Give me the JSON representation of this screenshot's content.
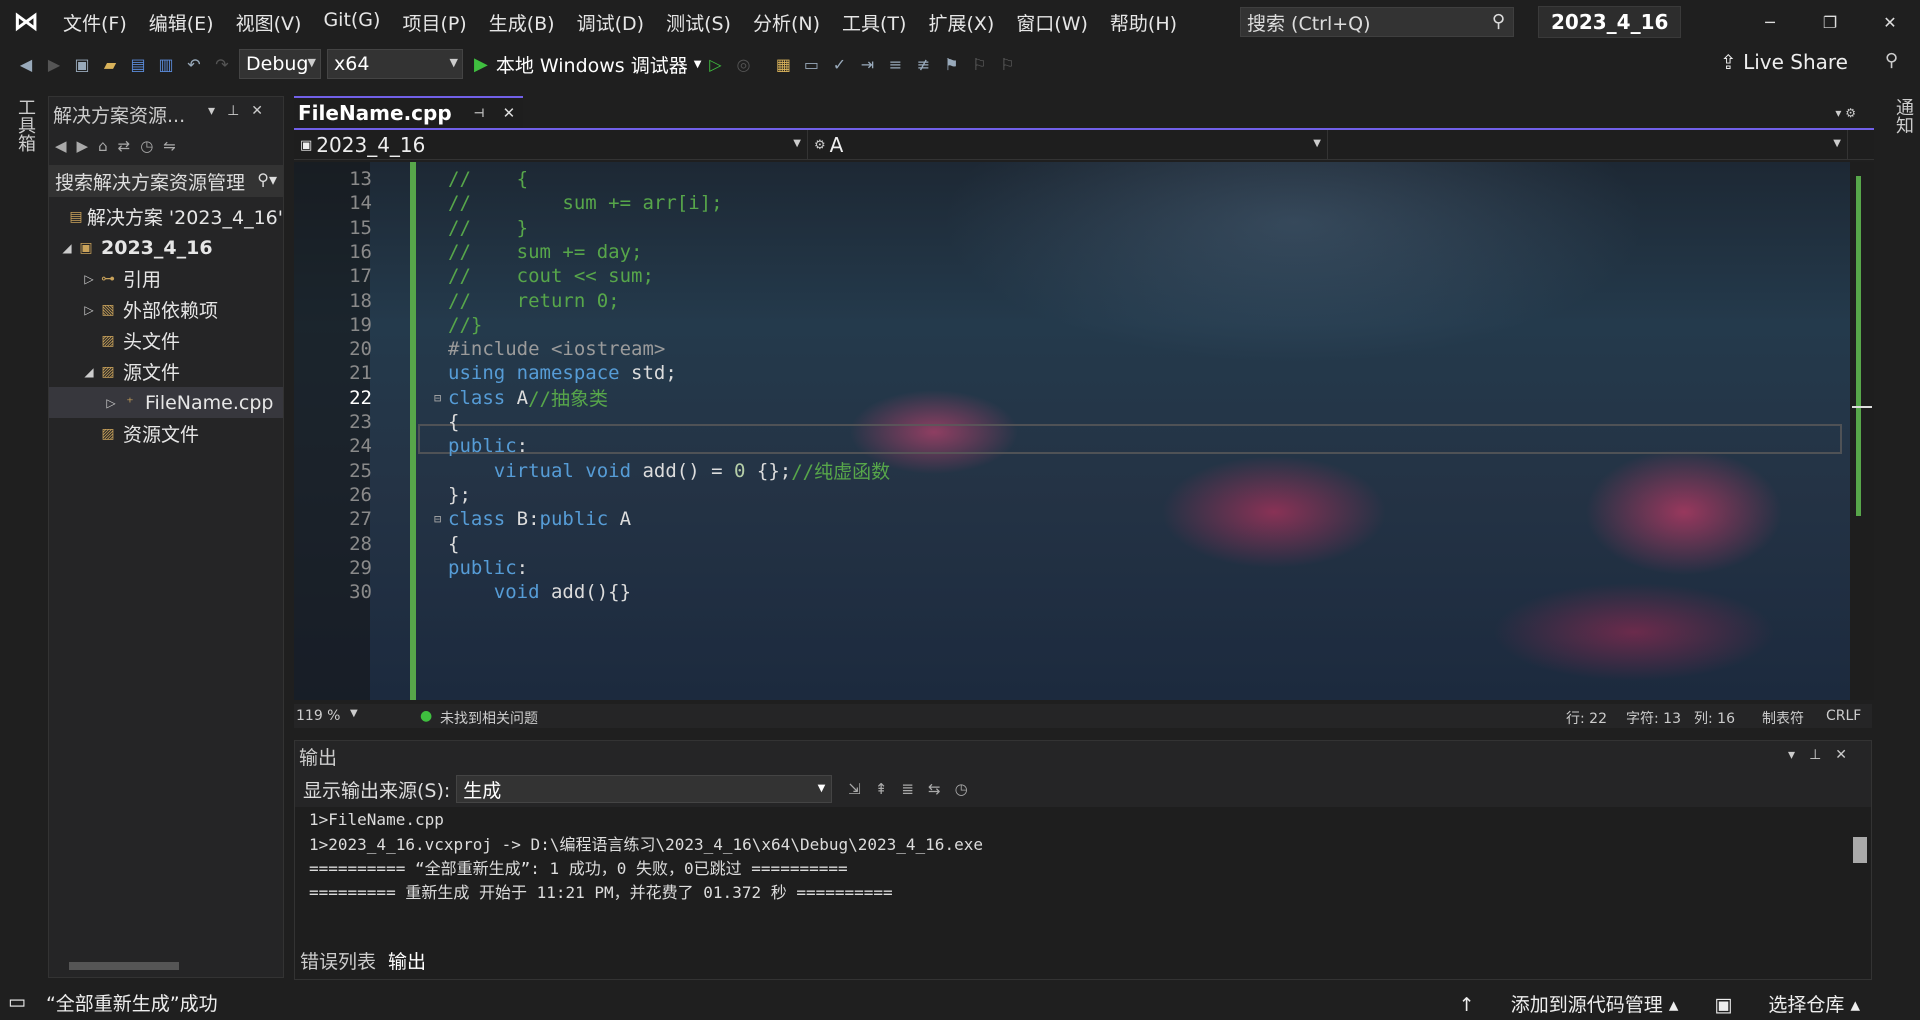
{
  "menubar": {
    "items": [
      "文件(F)",
      "编辑(E)",
      "视图(V)",
      "Git(G)",
      "项目(P)",
      "生成(B)",
      "调试(D)",
      "测试(S)",
      "分析(N)",
      "工具(T)",
      "扩展(X)",
      "窗口(W)",
      "帮助(H)"
    ],
    "search_placeholder": "搜索 (Ctrl+Q)",
    "project_title": "2023_4_16"
  },
  "toolbar": {
    "config": "Debug",
    "platform": "x64",
    "run_label": "本地 Windows 调试器",
    "live_share": "Live Share"
  },
  "side_strips": {
    "toolbox": "工具箱",
    "notifications": "通知"
  },
  "solution_explorer": {
    "title": "解决方案资源...",
    "search": "搜索解决方案资源管理",
    "tree": [
      {
        "label": "解决方案 '2023_4_16'",
        "indent": 0
      },
      {
        "label": "2023_4_16",
        "indent": 0
      },
      {
        "label": "引用",
        "indent": 1
      },
      {
        "label": "外部依赖项",
        "indent": 1
      },
      {
        "label": "头文件",
        "indent": 1
      },
      {
        "label": "源文件",
        "indent": 1
      },
      {
        "label": "FileName.cpp",
        "indent": 2
      },
      {
        "label": "资源文件",
        "indent": 1
      }
    ]
  },
  "editor": {
    "tab": "FileName.cpp",
    "nav_project": "2023_4_16",
    "nav_scope": "A",
    "current_line": 22,
    "lines": [
      {
        "n": 13,
        "tokens": [
          [
            "c-cm",
            "//    {"
          ]
        ]
      },
      {
        "n": 14,
        "tokens": [
          [
            "c-cm",
            "//        sum += arr[i];"
          ]
        ]
      },
      {
        "n": 15,
        "tokens": [
          [
            "c-cm",
            "//    }"
          ]
        ]
      },
      {
        "n": 16,
        "tokens": [
          [
            "c-cm",
            "//    sum += day;"
          ]
        ]
      },
      {
        "n": 17,
        "tokens": [
          [
            "c-cm",
            "//    cout << sum;"
          ]
        ]
      },
      {
        "n": 18,
        "tokens": [
          [
            "c-cm",
            "//    return 0;"
          ]
        ]
      },
      {
        "n": 19,
        "tokens": [
          [
            "c-cm",
            "//}"
          ]
        ]
      },
      {
        "n": 20,
        "tokens": [
          [
            "c-pp",
            "#include "
          ],
          [
            "c-pp",
            "<iostream>"
          ]
        ]
      },
      {
        "n": 21,
        "tokens": [
          [
            "c-kw",
            "using "
          ],
          [
            "c-kw",
            "namespace "
          ],
          [
            "c-id",
            "std;"
          ]
        ]
      },
      {
        "n": 22,
        "fold": true,
        "tokens": [
          [
            "c-kw",
            "class "
          ],
          [
            "c-id",
            "A"
          ],
          [
            "c-cm",
            "//抽象类"
          ]
        ]
      },
      {
        "n": 23,
        "tokens": [
          [
            "c-id",
            "{"
          ]
        ]
      },
      {
        "n": 24,
        "tokens": [
          [
            "c-kw",
            "public"
          ],
          [
            "c-id",
            ":"
          ]
        ]
      },
      {
        "n": 25,
        "tokens": [
          [
            "c-id",
            "    "
          ],
          [
            "c-kw",
            "virtual "
          ],
          [
            "c-kw",
            "void "
          ],
          [
            "c-id",
            "add() = "
          ],
          [
            "c-num",
            "0"
          ],
          [
            "c-id",
            " {};"
          ],
          [
            "c-cm",
            "//纯虚函数"
          ]
        ]
      },
      {
        "n": 26,
        "tokens": [
          [
            "c-id",
            "};"
          ]
        ]
      },
      {
        "n": 27,
        "fold": true,
        "tokens": [
          [
            "c-kw",
            "class "
          ],
          [
            "c-id",
            "B:"
          ],
          [
            "c-kw",
            "public "
          ],
          [
            "c-id",
            "A"
          ]
        ]
      },
      {
        "n": 28,
        "tokens": [
          [
            "c-id",
            "{"
          ]
        ]
      },
      {
        "n": 29,
        "tokens": [
          [
            "c-kw",
            "public"
          ],
          [
            "c-id",
            ":"
          ]
        ]
      },
      {
        "n": 30,
        "tokens": [
          [
            "c-id",
            "    "
          ],
          [
            "c-kw",
            "void "
          ],
          [
            "c-id",
            "add(){}"
          ]
        ]
      }
    ],
    "status": {
      "zoom": "119 %",
      "issues": "未找到相关问题",
      "row": "行: 22",
      "char": "字符: 13",
      "col": "列: 16",
      "tabs": "制表符",
      "eol": "CRLF"
    }
  },
  "output": {
    "title": "输出",
    "source_label": "显示输出来源(S):",
    "source_value": "生成",
    "lines": [
      "1>FileName.cpp",
      "1>2023_4_16.vcxproj -> D:\\编程语言练习\\2023_4_16\\x64\\Debug\\2023_4_16.exe",
      "========== “全部重新生成”: 1 成功，0 失败，0已跳过 ==========",
      "========= 重新生成 开始于 11:21 PM，并花费了 01.372 秒 =========="
    ]
  },
  "bottom_tabs": [
    "错误列表",
    "输出"
  ],
  "statusbar": {
    "message": "“全部重新生成”成功",
    "add_to_source": "添加到源代码管理",
    "select_repo": "选择仓库"
  },
  "colors": {
    "accent": "#7160e8",
    "change_bar": "#57a64a",
    "keyword": "#569cd6",
    "comment": "#57a64a"
  }
}
